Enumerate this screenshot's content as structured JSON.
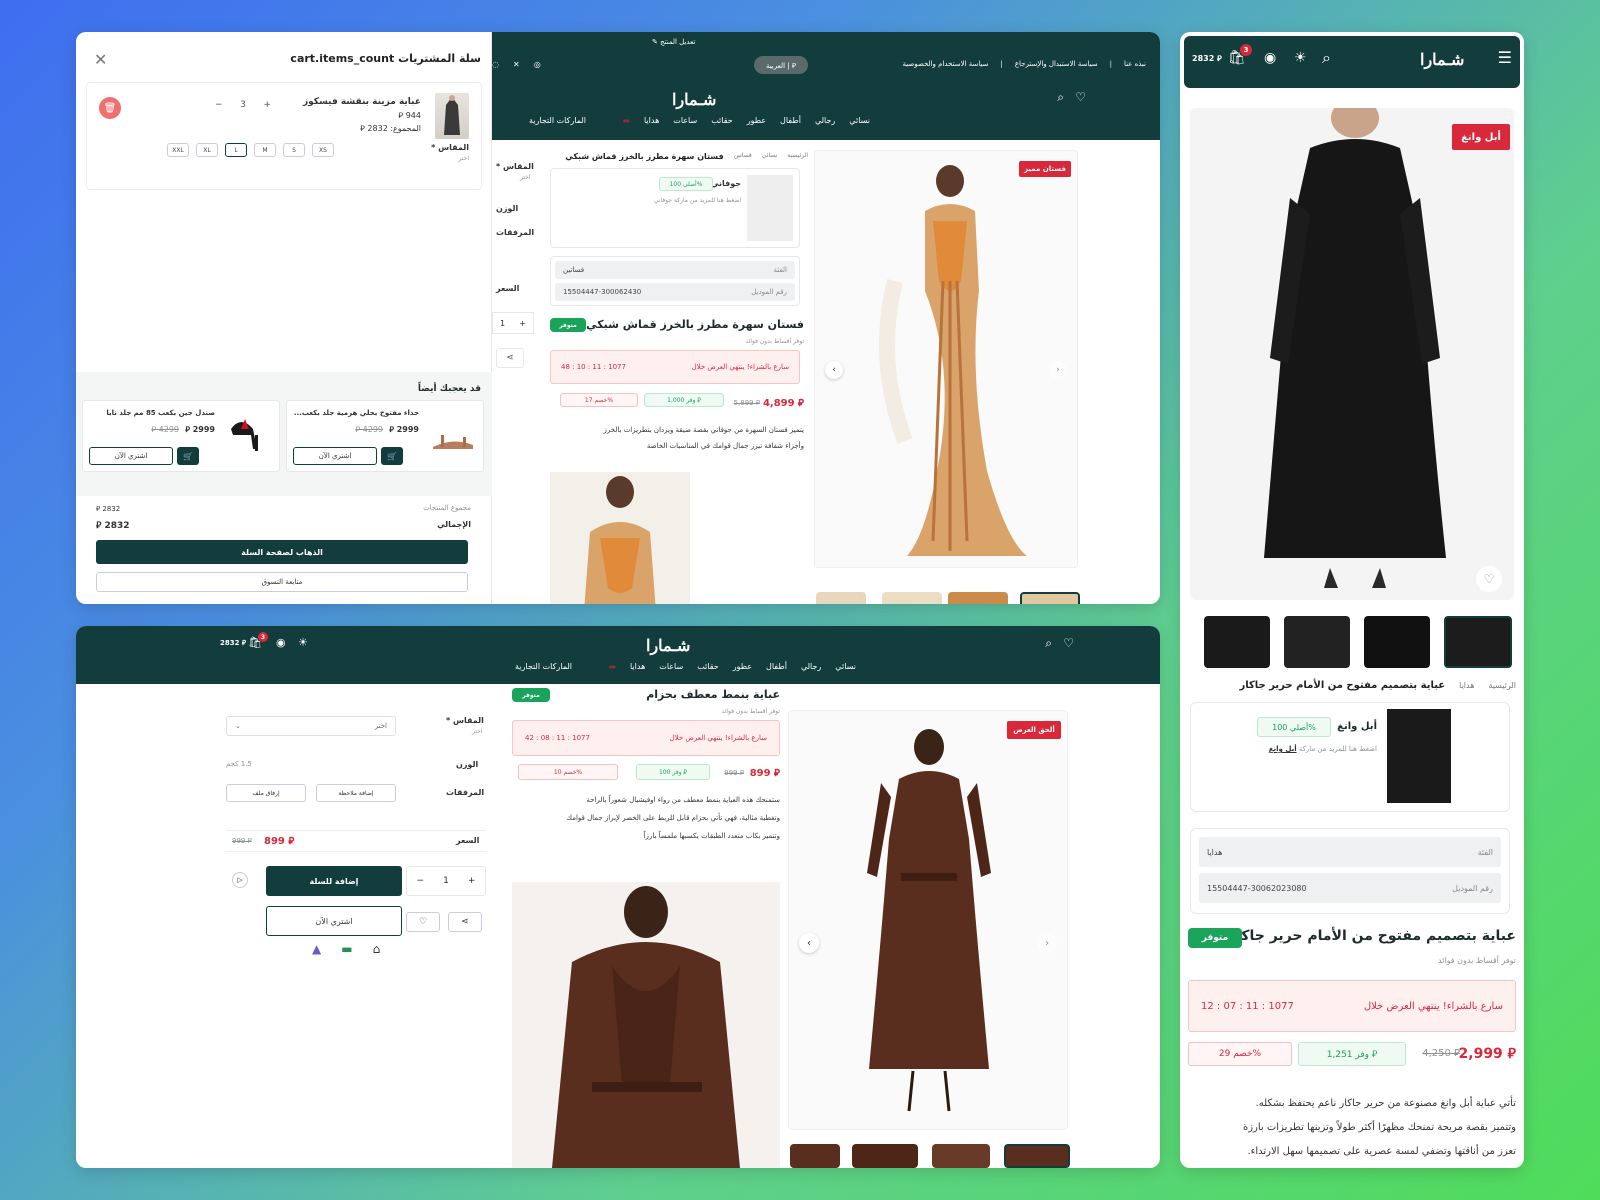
{
  "colors": {
    "brand": "#133c3c",
    "accent": "#d8283a",
    "success": "#19a35b"
  },
  "cart": {
    "title": "سلة المشتريات cart.items_count",
    "item_name": "عباية مزينة بنقشة فيسكوز",
    "item_price": "944 ⃁",
    "item_total": "المجموع: 2832 ⃁",
    "qty": "3",
    "size_label": "المقاس *",
    "size_hint": "اختر",
    "sizes": [
      "XXL",
      "XL",
      "L",
      "M",
      "S",
      "XS"
    ],
    "selected_size": "L",
    "recs_title": "قد يعجبك أيضاً",
    "recs": [
      {
        "name": "صندل جين بكعب 85 مم جلد نابا",
        "price": "2999 ⃁",
        "old": "4299 ⃁",
        "buy": "اشتري الآن"
      },
      {
        "name": "حذاء مفتوح بحلي هرمية جلد بكعب...",
        "price": "2999 ⃁",
        "old": "4299 ⃁",
        "buy": "اشتري الآن"
      }
    ],
    "subtotal_label": "مجموع المنتجات",
    "subtotal": "2832 ⃁",
    "total_label": "الإجمالي",
    "total": "2832 ⃁",
    "go_cart": "الذهاب لصفحة السلة",
    "continue": "متابعة التسوق"
  },
  "topbar": {
    "edit_product": "تعديل المنتج",
    "links": [
      "نبذه عنا",
      "سياسة الاستبدال والإسترجاع",
      "سياسة الاستخدام والخصوصية"
    ],
    "lang": "العربية | ⃁"
  },
  "brand_logo": "شـمارا",
  "nav": [
    "نسائي",
    "رجالي",
    "أطفال",
    "عطور",
    "حقائب",
    "ساعات",
    "هدايا",
    "",
    "الماركات التجارية"
  ],
  "p1": {
    "badge": "فستان مميز",
    "breadcrumb": [
      "الرئيسية",
      "نسائي",
      "فساتين"
    ],
    "current": "فستان سهرة مطرز بالخرز قماش شبكي",
    "brand": "جوفاني",
    "authentic": "أصلي 100%",
    "brand_hint": "اضغط هنا للمزيد من ماركة جوفاني",
    "cat_label": "الفئة",
    "cat": "فساتين",
    "model_label": "رقم الموديل",
    "model": "15504447-300062430",
    "title": "فستان سهرة مطرز بالخرز قماش شبكي",
    "available": "متوفر",
    "installments": "توفر أقساط بدون فوائد",
    "promo": "سارع بالشراء! ينتهي العرض خلال",
    "timer": "48 : 10 : 11 : 1077",
    "price": "4,899 ⃁",
    "old": "5,899 ⃁",
    "save": "وفر 1,000 ⃁",
    "discount": "خصم 17%",
    "desc1": "يتميز فستان السهرة من جوفاني بقصة ضيقة ويزدان بتطريزات بالخرز",
    "desc2": "وأجزاء شفافة تبرز جمال قوامك في المناسبات الخاصة",
    "size": "المقاس *",
    "size_hint": "اختر",
    "weight": "الوزن",
    "attachments": "المرفقات",
    "price_label": "السعر",
    "qty": "1"
  },
  "p2": {
    "cart_total": "2832 ⃁",
    "cart_count": "3",
    "badge": "ألحق العرض",
    "title": "عباية بنمط معطف بحزام",
    "available": "متوفر",
    "installments": "توفر أقساط بدون فوائد",
    "promo": "سارع بالشراء! ينتهي العرض خلال",
    "timer": "42 : 08 : 11 : 1077",
    "price": "899 ⃁",
    "old": "999 ⃁",
    "save": "وفر 100 ⃁",
    "discount": "خصم 10%",
    "desc1": "ستمنحك هذه العباية بنمط معطف من رواء اوفيشيال شعوراً بالراحة",
    "desc2": "وتغطية مثالية، فهي تأتي بحزام قابل للربط على الخصر لإبراز جمال قوامك",
    "desc3": "وتتميز بكاب متعدد الطبقات يكسبها ملمساً بارزاً",
    "size": "المقاس *",
    "size_hint": "اختر",
    "select_placeholder": "اختر",
    "weight": "الوزن",
    "weight_val": "1.5 كجم",
    "attachments": "المرفقات",
    "add_note": "إضافة ملاحظة",
    "attach_file": "إرفاق ملف",
    "price_label": "السعر",
    "price_side": "899 ⃁",
    "old_side": "999 ⃁",
    "qty": "1",
    "add_cart": "إضافة للسلة",
    "buy_now": "اشتري الآن"
  },
  "p3": {
    "cart_total": "2832 ⃁",
    "cart_count": "3",
    "badge": "أبل وانغ",
    "breadcrumb": [
      "الرئيسية",
      "هدايا"
    ],
    "current": "عباية بتصميم مفتوح من الأمام حرير جاكار",
    "brand": "أبل وانغ",
    "authentic": "أصلي 100%",
    "brand_hint": "اضغط هنا للمزيد من ماركة",
    "brand_link": "أبل وانغ",
    "cat_label": "الفئة",
    "cat": "هدايا",
    "model_label": "رقم الموديل",
    "model": "15504447-30062023080",
    "title": "عباية بتصميم مفتوح من الأمام حرير جاكار",
    "available": "متوفر",
    "installments": "توفر أقساط بدون فوائد",
    "promo": "سارع بالشراء! ينتهي العرض خلال",
    "timer": "12 : 07 : 11 : 1077",
    "price": "2,999 ⃁",
    "old": "4,250 ⃁",
    "save": "وفر 1,251 ⃁",
    "discount": "خصم 29%",
    "desc1": "تأتي عباية أبل وانغ مصنوعة من حرير جاكار ناعم يحتفظ بشكله.",
    "desc2": "وتتميز بقصة مريحة تمنحك مظهرًا أكثر طولاً وتزينها تطريزات بارزة",
    "desc3": "تعزز من أناقتها وتضفي لمسة عصرية على تصميمها سهل الارتداء."
  }
}
